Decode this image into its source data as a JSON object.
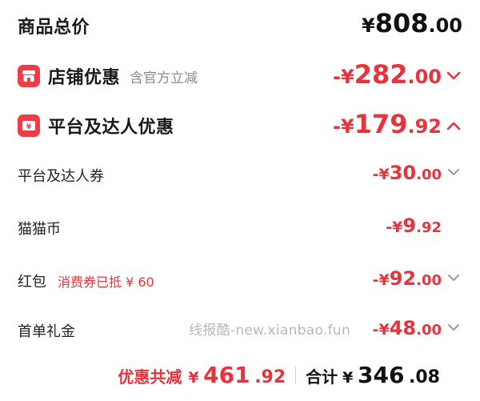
{
  "summary": {
    "label": "商品总价",
    "currency": "¥",
    "amount_int": "808",
    "amount_dec": ".00"
  },
  "store_discount": {
    "label": "店铺优惠",
    "hint": "含官方立减",
    "prefix": "-¥",
    "amount_int": "282",
    "amount_dec": ".00",
    "icon": "shop-icon",
    "expanded": false
  },
  "platform_discount": {
    "label": "平台及达人优惠",
    "prefix": "-¥",
    "amount_int": "179",
    "amount_dec": ".92",
    "icon": "coupon-icon",
    "expanded": true,
    "items": [
      {
        "label": "平台及达人券",
        "hint": "",
        "prefix": "-¥",
        "amount_int": "30",
        "amount_dec": ".00",
        "chevron": true
      },
      {
        "label": "猫猫币",
        "hint": "",
        "prefix": "-¥",
        "amount_int": "9",
        "amount_dec": ".92",
        "chevron": false
      },
      {
        "label": "红包",
        "hint": "消费券已抵 ¥ 60",
        "prefix": "-¥",
        "amount_int": "92",
        "amount_dec": ".00",
        "chevron": true
      },
      {
        "label": "首单礼金",
        "hint": "",
        "prefix": "-¥",
        "amount_int": "48",
        "amount_dec": ".00",
        "chevron": true
      }
    ]
  },
  "watermark": "线报酷-new.xianbao.fun",
  "footer": {
    "discount_label": "优惠共减",
    "discount_currency": "¥",
    "discount_int": "461",
    "discount_dec": ".92",
    "total_label": "合计",
    "total_currency": "¥",
    "total_int": "346",
    "total_dec": ".08"
  },
  "colors": {
    "accent_red": "#e8323c",
    "icon_red": "#ee3d46",
    "text": "#111111",
    "muted": "#8a8a8a"
  }
}
